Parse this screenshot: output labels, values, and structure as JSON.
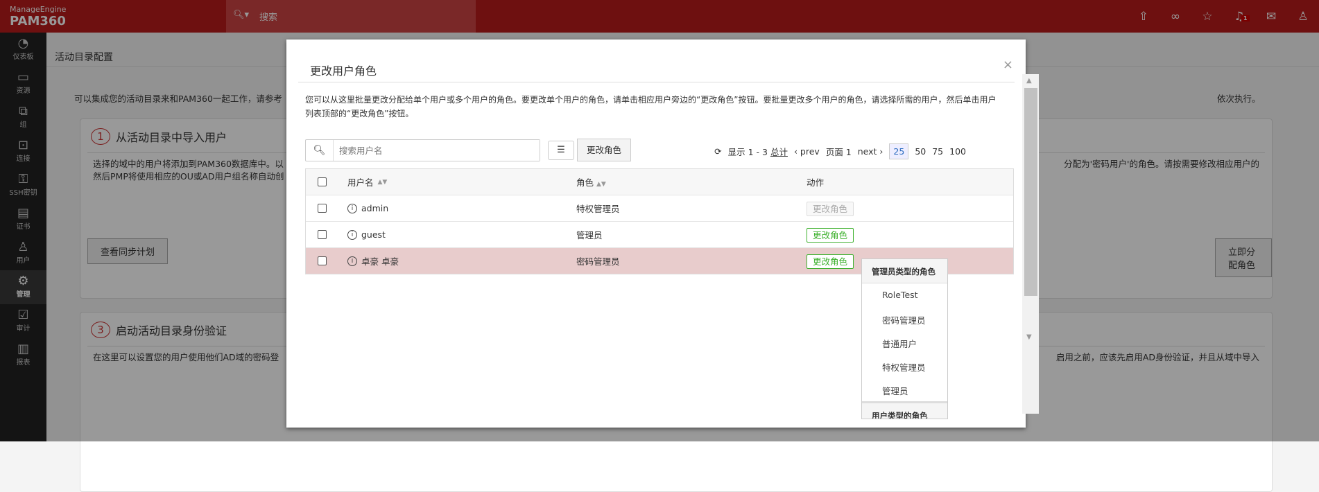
{
  "header": {
    "brand_top": "ManageEngine",
    "brand": "PAM360",
    "search_placeholder": "搜索",
    "notification_count": "1"
  },
  "sidebar": {
    "items": [
      {
        "label": "仪表板",
        "icon": "dashboard-icon",
        "glyph": "◔"
      },
      {
        "label": "资源",
        "icon": "monitor-icon",
        "glyph": "▭"
      },
      {
        "label": "组",
        "icon": "group-icon",
        "glyph": "⧉"
      },
      {
        "label": "连接",
        "icon": "connection-icon",
        "glyph": "⊡"
      },
      {
        "label": "SSH密钥",
        "icon": "ssh-key-icon",
        "glyph": "⚿"
      },
      {
        "label": "证书",
        "icon": "certificate-icon",
        "glyph": "▤"
      },
      {
        "label": "用户",
        "icon": "user-icon",
        "glyph": "♙"
      },
      {
        "label": "管理",
        "icon": "gear-icon",
        "glyph": "⚙"
      },
      {
        "label": "审计",
        "icon": "audit-icon",
        "glyph": "☑"
      },
      {
        "label": "报表",
        "icon": "report-icon",
        "glyph": "▥"
      }
    ]
  },
  "page": {
    "title": "活动目录配置",
    "intro": "可以集成您的活动目录来和PAM360一起工作，请参考",
    "intro_end": "依次执行。",
    "card1": {
      "num": "1",
      "title": "从活动目录中导入用户",
      "text1": "选择的域中的用户将添加到PAM360数据库中。以",
      "text2": "然后PMP将使用相应的OU或AD用户组名称自动创",
      "text_right": "分配为'密码用户'的角色。请按需要修改相应用户的",
      "button": "查看同步计划",
      "button_right": "立即分配角色"
    },
    "card3": {
      "num": "3",
      "title": "启动活动目录身份验证",
      "text1": "在这里可以设置您的用户使用他们AD域的密码登",
      "text_right": "启用之前，应该先启用AD身份验证，并且从域中导入"
    }
  },
  "modal": {
    "title": "更改用户角色",
    "close": "×",
    "description": "您可以从这里批量更改分配给单个用户或多个用户的角色。要更改单个用户的角色，请单击相应用户旁边的“更改角色”按钮。要批量更改多个用户的角色，请选择所需的用户，然后单击用户列表顶部的“更改角色”按钮。",
    "search_placeholder": "搜索用户名",
    "change_role_button": "更改角色",
    "pagination": {
      "showing": "显示 1 - 3",
      "total": "总计",
      "prev": "‹ prev",
      "page": "页面 1",
      "next": "next ›",
      "sizes": [
        "25",
        "50",
        "75",
        "100"
      ]
    },
    "columns": [
      "用户名",
      "角色",
      "动作"
    ],
    "rows": [
      {
        "user": "admin",
        "role": "特权管理员",
        "action": "更改角色",
        "disabled": true
      },
      {
        "user": "guest",
        "role": "管理员",
        "action": "更改角色"
      },
      {
        "user": "卓豪 卓豪",
        "role": "密码管理员",
        "action": "更改角色",
        "highlight": true
      }
    ],
    "dropdown": {
      "group1": "管理员类型的角色",
      "items": [
        "RoleTest",
        "密码管理员",
        "普通用户",
        "特权管理员",
        "管理员"
      ],
      "group2": "用户类型的角色"
    }
  }
}
